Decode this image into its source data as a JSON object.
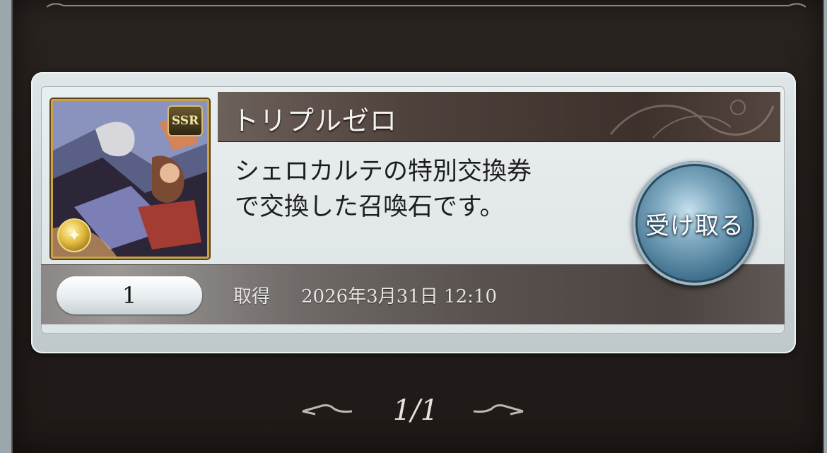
{
  "item": {
    "name": "トリプルゼロ",
    "rarity": "SSR",
    "description_line1": "シェロカルテの特別交換券",
    "description_line2": "で交換した召喚石です。",
    "quantity": "1",
    "acquired_label": "取得",
    "acquired_datetime": "2026年3月31日 12:10",
    "element_icon": "light-element-icon"
  },
  "actions": {
    "receive_label": "受け取る"
  },
  "pager": {
    "indicator": "1/1"
  },
  "colors": {
    "frame_bg": "#221d1a",
    "card_bg": "#dde4e6",
    "title_bar": "#4e403b",
    "button_blue": "#3c6d8b",
    "ssr_gold": "#c9a24a"
  }
}
